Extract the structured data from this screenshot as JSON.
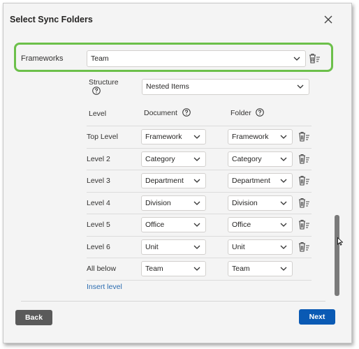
{
  "dialog": {
    "title": "Select Sync Folders",
    "close_icon": "close-icon"
  },
  "frameworks": {
    "label": "Frameworks",
    "value": "Team",
    "trash_icon": "trash-filter-icon"
  },
  "structure": {
    "label": "Structure",
    "value": "Nested Items",
    "help_icon": "help-circle-icon"
  },
  "columns": {
    "level": "Level",
    "document": "Document",
    "folder": "Folder"
  },
  "levels": [
    {
      "label": "Top Level",
      "document": "Framework",
      "folder": "Framework",
      "has_trash": true
    },
    {
      "label": "Level 2",
      "document": "Category",
      "folder": "Category",
      "has_trash": true
    },
    {
      "label": "Level 3",
      "document": "Department",
      "folder": "Department",
      "has_trash": true
    },
    {
      "label": "Level 4",
      "document": "Division",
      "folder": "Division",
      "has_trash": true
    },
    {
      "label": "Level 5",
      "document": "Office",
      "folder": "Office",
      "has_trash": true
    },
    {
      "label": "Level 6",
      "document": "Unit",
      "folder": "Unit",
      "has_trash": true
    },
    {
      "label": "All below",
      "document": "Team",
      "folder": "Team",
      "has_trash": false
    }
  ],
  "insert_level": "Insert level",
  "buttons": {
    "back": "Back",
    "next": "Next"
  },
  "colors": {
    "highlight": "#6cc04a",
    "primary": "#0a5ab4",
    "secondary": "#5a5a5a",
    "link": "#2b6cb0"
  }
}
